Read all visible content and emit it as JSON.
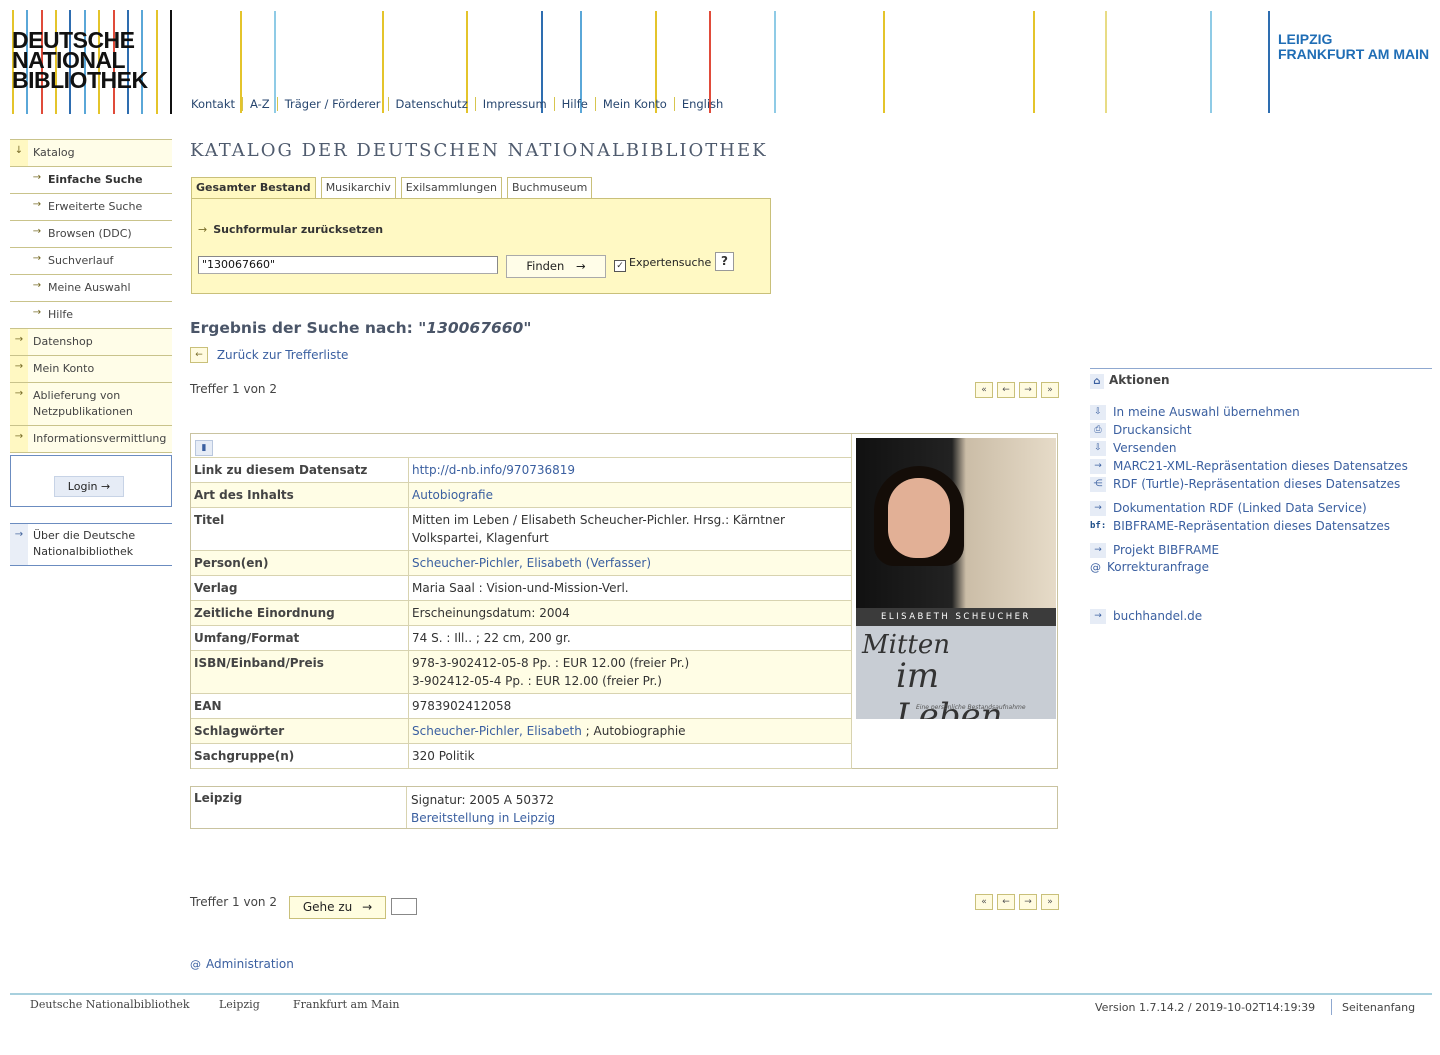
{
  "logo": {
    "lines": [
      "DEUTSCHE",
      "NATIONAL",
      "BIBLIOTHEK"
    ]
  },
  "top_nav": [
    "Kontakt",
    "A-Z",
    "Träger / Förderer",
    "Datenschutz",
    "Impressum",
    "Hilfe",
    "Mein Konto",
    "English"
  ],
  "locations": [
    "LEIPZIG",
    "FRANKFURT AM MAIN"
  ],
  "left_nav": {
    "items": [
      {
        "label": "Katalog",
        "type": "main",
        "icon": "arrow-down-icon"
      },
      {
        "label": "Einfache Suche",
        "type": "sub",
        "active": true
      },
      {
        "label": "Erweiterte Suche",
        "type": "sub"
      },
      {
        "label": "Browsen (DDC)",
        "type": "sub"
      },
      {
        "label": "Suchverlauf",
        "type": "sub"
      },
      {
        "label": "Meine Auswahl",
        "type": "sub"
      },
      {
        "label": "Hilfe",
        "type": "sub"
      },
      {
        "label": "Datenshop",
        "type": "main"
      },
      {
        "label": "Mein Konto",
        "type": "main"
      },
      {
        "label": "Ablieferung von Netzpublikationen",
        "type": "main"
      },
      {
        "label": "Informationsvermittlung",
        "type": "main"
      }
    ],
    "login_label": "Login",
    "about_label": "Über die Deutsche Nationalbibliothek"
  },
  "main": {
    "title": "KATALOG DER DEUTSCHEN NATIONALBIBLIOTHEK",
    "tabs": [
      "Gesamter Bestand",
      "Musikarchiv",
      "Exilsammlungen",
      "Buchmuseum"
    ],
    "reset_label": "Suchformular zurücksetzen",
    "search_value": "\"130067660\"",
    "find_label": "Finden",
    "expert_label": "Expertensuche",
    "expert_checked": true,
    "help_label": "?",
    "result_prefix": "Ergebnis der Suche nach: ",
    "result_query": "\"130067660\"",
    "back_label": "Zurück zur Trefferliste",
    "treffer": "Treffer 1 von 2",
    "goto_label": "Gehe zu",
    "admin_label": "Administration"
  },
  "record": {
    "rows": [
      {
        "key": "Link zu diesem Datensatz",
        "value": "http://d-nb.info/970736819",
        "link": true,
        "alt": false
      },
      {
        "key": "Art des Inhalts",
        "value": "Autobiografie",
        "link": true,
        "alt": true
      },
      {
        "key": "Titel",
        "value": "Mitten im Leben / Elisabeth Scheucher-Pichler. Hrsg.: Kärntner Volkspartei, Klagenfurt",
        "link": false,
        "alt": false
      },
      {
        "key": "Person(en)",
        "value": "Scheucher-Pichler, Elisabeth (Verfasser)",
        "link": true,
        "alt": true
      },
      {
        "key": "Verlag",
        "value": "Maria Saal : Vision-und-Mission-Verl.",
        "link": false,
        "alt": false
      },
      {
        "key": "Zeitliche Einordnung",
        "value": "Erscheinungsdatum: 2004",
        "link": false,
        "alt": true
      },
      {
        "key": "Umfang/Format",
        "value": "74 S. : Ill.. ; 22 cm, 200 gr.",
        "link": false,
        "alt": false
      },
      {
        "key": "ISBN/Einband/Preis",
        "value": "978-3-902412-05-8 Pp. : EUR 12.00 (freier Pr.)",
        "value2": "3-902412-05-4 Pp. : EUR 12.00 (freier Pr.)",
        "link": false,
        "alt": true
      },
      {
        "key": "EAN",
        "value": "9783902412058",
        "link": false,
        "alt": false
      },
      {
        "key": "Schlagwörter",
        "value": "Scheucher-Pichler, Elisabeth",
        "suffix": " ; Autobiographie",
        "link": true,
        "alt": true
      },
      {
        "key": "Sachgruppe(n)",
        "value": "320 Politik",
        "link": false,
        "alt": false
      }
    ],
    "cover": {
      "author_band": "ELISABETH SCHEUCHER",
      "title_line1": "Mitten",
      "title_line2": "im Leben",
      "subtitle": "Eine persönliche Bestandsaufnahme"
    }
  },
  "holding": {
    "location": "Leipzig",
    "signatur": "Signatur: 2005 A 50372",
    "link": "Bereitstellung in Leipzig"
  },
  "actions": {
    "heading": "Aktionen",
    "items": [
      {
        "label": "In meine Auswahl übernehmen",
        "icon": "download-icon"
      },
      {
        "label": "Druckansicht",
        "icon": "printer-icon"
      },
      {
        "label": "Versenden",
        "icon": "send-icon"
      },
      {
        "label": "MARC21-XML-Repräsentation dieses Datensatzes",
        "icon": "arrow-right-icon"
      },
      {
        "label": "RDF (Turtle)-Repräsentation dieses Datensatzes",
        "icon": "share-icon"
      },
      {
        "label": "Dokumentation RDF (Linked Data Service)",
        "icon": "arrow-right-icon"
      },
      {
        "label": "BIBFRAME-Repräsentation dieses Datensatzes",
        "icon": "bibframe-icon"
      },
      {
        "label": "Projekt BIBFRAME",
        "icon": "arrow-right-icon"
      },
      {
        "label": "Korrekturanfrage",
        "icon": "at-icon"
      },
      {
        "label": "buchhandel.de",
        "icon": "arrow-right-icon"
      }
    ]
  },
  "footer": {
    "links": [
      "Deutsche Nationalbibliothek",
      "Leipzig",
      "Frankfurt am Main"
    ],
    "version": "Version 1.7.14.2 / 2019-10-02T14:19:39",
    "top_link": "Seitenanfang"
  },
  "colors": {
    "accent_yellow": "#fff9c4",
    "link_blue": "#3a5fa0",
    "brand_blue": "#1f6db5"
  }
}
